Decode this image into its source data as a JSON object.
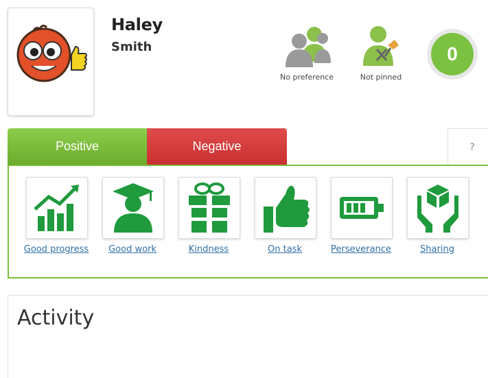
{
  "student": {
    "first_name": "Haley",
    "last_name": "Smith"
  },
  "status": {
    "preference_label": "No preference",
    "pinned_label": "Not pinned",
    "points": "0"
  },
  "tabs": {
    "positive": "Positive",
    "negative": "Negative",
    "help": "?"
  },
  "awards": [
    {
      "label": "Good progress",
      "icon": "chart-up-icon"
    },
    {
      "label": "Good work",
      "icon": "graduate-icon"
    },
    {
      "label": "Kindness",
      "icon": "gift-icon"
    },
    {
      "label": "On task",
      "icon": "thumbs-up-icon"
    },
    {
      "label": "Perseverance",
      "icon": "battery-icon"
    },
    {
      "label": "Sharing",
      "icon": "hands-box-icon"
    }
  ],
  "activity": {
    "title": "Activity"
  },
  "colors": {
    "positive": "#7cc242",
    "negative": "#d63c3c",
    "link": "#2f6fa6",
    "icon_green": "#1f9a3c"
  }
}
